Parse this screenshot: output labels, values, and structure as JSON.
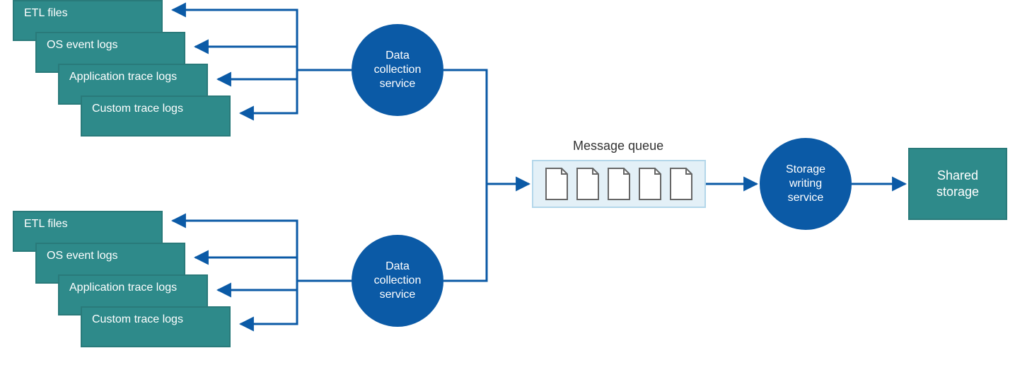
{
  "stack1": {
    "etl": "ETL files",
    "os": "OS event logs",
    "app": "Application trace logs",
    "custom": "Custom trace logs"
  },
  "stack2": {
    "etl": "ETL files",
    "os": "OS event logs",
    "app": "Application trace logs",
    "custom": "Custom trace logs"
  },
  "collector1": "Data\ncollection\nservice",
  "collector2": "Data\ncollection\nservice",
  "queue_label": "Message queue",
  "queue_doc_count": 5,
  "storage_service": "Storage\nwriting\nservice",
  "shared_storage": "Shared\nstorage",
  "colors": {
    "teal": "#2e8a8a",
    "blue_dark": "#0b5aa6",
    "connector": "#0b5aa6",
    "queue_bg": "#e3f0f7",
    "queue_border": "#b3d7ea",
    "doc_stroke": "#666"
  }
}
